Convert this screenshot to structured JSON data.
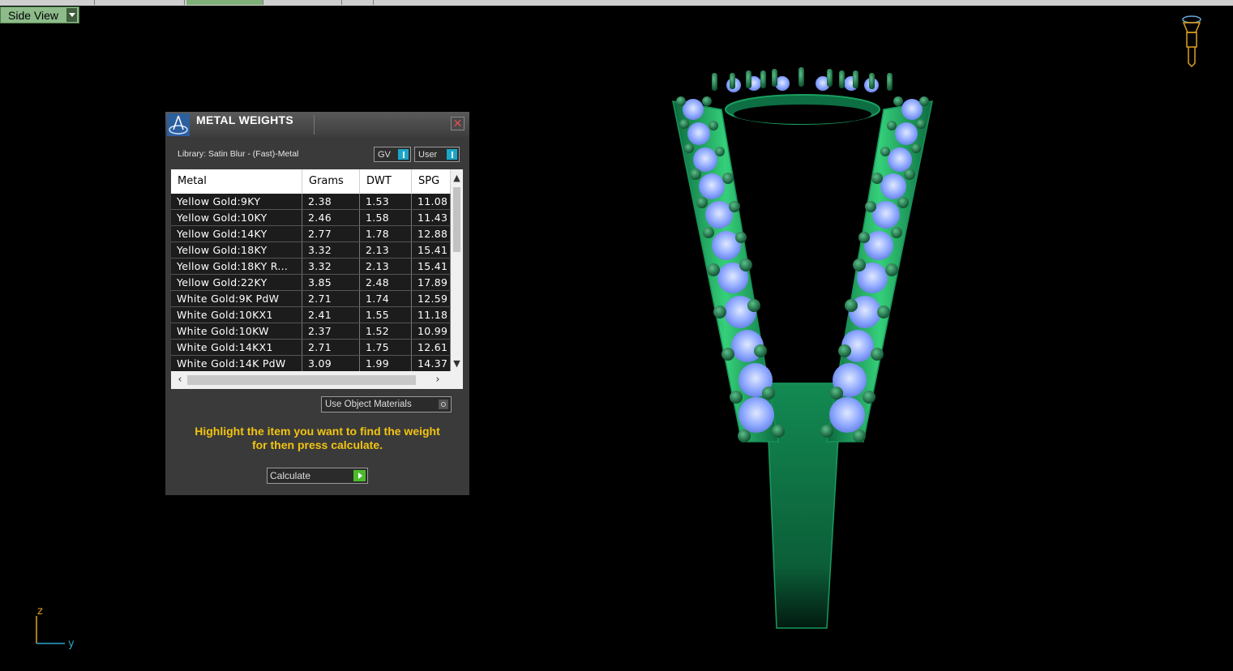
{
  "view_label": {
    "text": "Side View"
  },
  "panel": {
    "title": "METAL WEIGHTS",
    "library": "Library: Satin Blur - (Fast)-Metal",
    "toggles": {
      "gv": "GV",
      "user": "User"
    },
    "columns": [
      "Metal",
      "Grams",
      "DWT",
      "SPG"
    ],
    "rows": [
      {
        "metal": "Yellow Gold:9KY",
        "grams": "2.38",
        "dwt": "1.53",
        "spg": "11.08"
      },
      {
        "metal": "Yellow Gold:10KY",
        "grams": "2.46",
        "dwt": "1.58",
        "spg": "11.43"
      },
      {
        "metal": "Yellow Gold:14KY",
        "grams": "2.77",
        "dwt": "1.78",
        "spg": "12.88"
      },
      {
        "metal": "Yellow Gold:18KY",
        "grams": "3.32",
        "dwt": "2.13",
        "spg": "15.41"
      },
      {
        "metal": "Yellow Gold:18KY R...",
        "grams": "3.32",
        "dwt": "2.13",
        "spg": "15.41"
      },
      {
        "metal": "Yellow Gold:22KY",
        "grams": "3.85",
        "dwt": "2.48",
        "spg": "17.89"
      },
      {
        "metal": "White Gold:9K PdW",
        "grams": "2.71",
        "dwt": "1.74",
        "spg": "12.59"
      },
      {
        "metal": "White Gold:10KX1",
        "grams": "2.41",
        "dwt": "1.55",
        "spg": "11.18"
      },
      {
        "metal": "White Gold:10KW",
        "grams": "2.37",
        "dwt": "1.52",
        "spg": "10.99"
      },
      {
        "metal": "White Gold:14KX1",
        "grams": "2.71",
        "dwt": "1.75",
        "spg": "12.61"
      },
      {
        "metal": "White Gold:14K PdW",
        "grams": "3.09",
        "dwt": "1.99",
        "spg": "14.37"
      }
    ],
    "use_object_materials": "Use Object Materials",
    "hint_line1": "Highlight the item you want to find the weight",
    "hint_line2": "for then press calculate.",
    "calculate": "Calculate"
  },
  "axes": {
    "vertical": "z",
    "horizontal": "y"
  },
  "colors": {
    "background": "#000000",
    "model_green": "#0f7a4a",
    "gem_blue": "#8fb0ff",
    "hint_yellow": "#f2c411",
    "axis_orange": "#e0a020",
    "axis_cyan": "#2aa6c8"
  },
  "icons": [
    "panel-logo-icon",
    "close-icon",
    "dropdown-icon",
    "gv-toggle-icon",
    "user-toggle-icon",
    "radio-icon",
    "play-icon",
    "camera-gizmo-icon"
  ]
}
